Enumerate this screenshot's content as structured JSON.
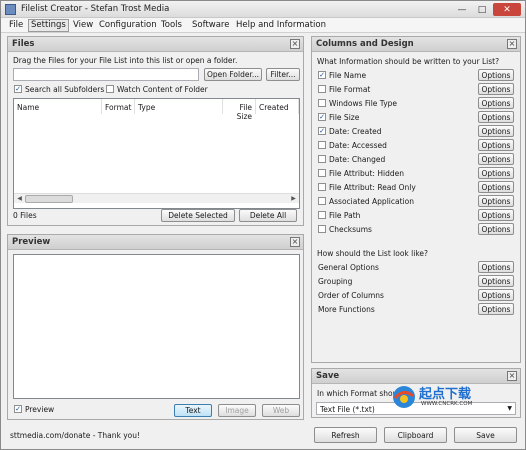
{
  "window": {
    "title": "Filelist Creator - Stefan Trost Media",
    "min": "—",
    "max": "□",
    "close": "✕"
  },
  "menu": [
    "File",
    "Settings",
    "View",
    "Configuration",
    "Tools",
    "Software",
    "Help and Information"
  ],
  "files_panel": {
    "title": "Files",
    "instruction": "Drag the Files for your File List into this list or open a folder.",
    "path_value": "",
    "open_folder": "Open Folder...",
    "filter": "Filter...",
    "search_subfolders": "Search all Subfolders",
    "search_subfolders_checked": true,
    "watch_folder": "Watch Content of Folder",
    "watch_folder_checked": false,
    "columns": [
      "Name",
      "Format",
      "Type",
      "File Size",
      "Created"
    ],
    "count": "0 Files",
    "delete_selected": "Delete Selected",
    "delete_all": "Delete All"
  },
  "preview_panel": {
    "title": "Preview",
    "preview_label": "Preview",
    "preview_checked": true,
    "tabs": [
      "Text",
      "Image",
      "Web"
    ]
  },
  "status_text": "sttmedia.com/donate - Thank you!",
  "columns_panel": {
    "title": "Columns and Design",
    "question": "What Information should be written to your List?",
    "options_label": "Options",
    "items": [
      {
        "label": "File Name",
        "checked": true
      },
      {
        "label": "File Format",
        "checked": false
      },
      {
        "label": "Windows File Type",
        "checked": false
      },
      {
        "label": "File Size",
        "checked": true
      },
      {
        "label": "Date: Created",
        "checked": true
      },
      {
        "label": "Date: Accessed",
        "checked": false
      },
      {
        "label": "Date: Changed",
        "checked": false
      },
      {
        "label": "File Attribut: Hidden",
        "checked": false
      },
      {
        "label": "File Attribut: Read Only",
        "checked": false
      },
      {
        "label": "Associated Application",
        "checked": false
      },
      {
        "label": "File Path",
        "checked": false
      },
      {
        "label": "Checksums",
        "checked": false
      }
    ],
    "look_question": "How should the List look like?",
    "look_items": [
      "General Options",
      "Grouping",
      "Order of Columns",
      "More Functions"
    ]
  },
  "save_panel": {
    "title": "Save",
    "question": "In which Format should",
    "format_value": "Text File (*.txt)"
  },
  "bottom_buttons": {
    "refresh": "Refresh",
    "clipboard": "Clipboard",
    "save": "Save"
  },
  "watermark": {
    "brand": "起点下载",
    "url": "WWW.CNCRK.COM"
  }
}
